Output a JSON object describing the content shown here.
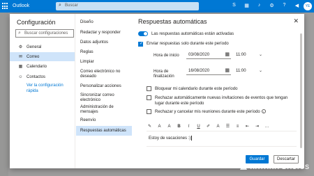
{
  "app": {
    "name": "Outlook",
    "search_placeholder": "Buscar",
    "avatar_initials": "YE",
    "top_icons": [
      "skype-icon",
      "calendar-check-icon",
      "bell-icon",
      "gear-icon",
      "help-icon",
      "megaphone-icon"
    ]
  },
  "nav": {
    "title": "Configuración",
    "search_placeholder": "Buscar configuraciones",
    "items": [
      {
        "label": "General",
        "icon": "gear-icon",
        "active": false
      },
      {
        "label": "Correo",
        "icon": "mail-icon",
        "active": true
      },
      {
        "label": "Calendario",
        "icon": "calendar-icon",
        "active": false
      },
      {
        "label": "Contactos",
        "icon": "people-icon",
        "active": false
      }
    ],
    "quick_settings_link": "Ver la configuración rápida"
  },
  "submenu": {
    "items": [
      {
        "label": "Diseño"
      },
      {
        "label": "Redactar y responder"
      },
      {
        "label": "Datos adjuntos"
      },
      {
        "label": "Reglas"
      },
      {
        "label": "Limpiar"
      },
      {
        "label": "Correo electrónico no deseado"
      },
      {
        "label": "Personalizar acciones"
      },
      {
        "label": "Sincronizar correo electrónico"
      },
      {
        "label": "Administración de mensajes"
      },
      {
        "label": "Reenvío"
      },
      {
        "label": "Respuestas automáticas",
        "active": true
      }
    ]
  },
  "pane": {
    "title": "Respuestas automáticas",
    "toggle_label": "Las respuestas automáticas están activadas",
    "toggle_on": true,
    "period_checkbox": {
      "label": "Enviar respuestas solo durante este período",
      "checked": true
    },
    "start": {
      "label": "Hora de inicio",
      "date": "03/08/2020",
      "time": "11:00"
    },
    "end": {
      "label": "Hora de finalización",
      "date": "16/08/2020",
      "time": "11:00"
    },
    "options": [
      {
        "label": "Bloquear mi calendario durante este período",
        "checked": false
      },
      {
        "label": "Rechazar automáticamente nuevas invitaciones de eventos que tengan lugar durante este período",
        "checked": false
      },
      {
        "label": "Rechazar y cancelar mis reuniones durante este período",
        "checked": false
      }
    ],
    "message": "Estoy de vacaciones :)",
    "save_label": "Guardar",
    "discard_label": "Descartar"
  },
  "watermark": {
    "text": "XATAKA BASICS"
  }
}
